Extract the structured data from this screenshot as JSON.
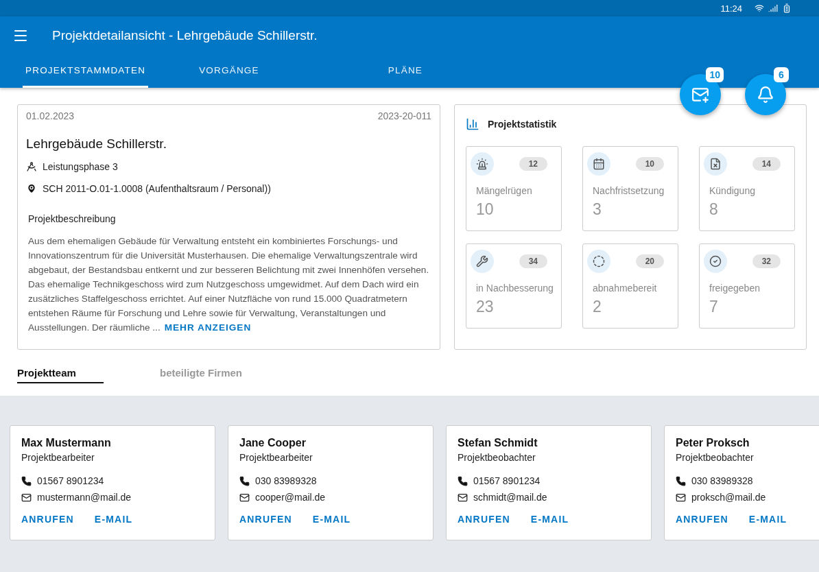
{
  "status_bar": {
    "time": "11:24"
  },
  "app_bar": {
    "title": "Projektdetailansicht - Lehrgebäude Schillerstr."
  },
  "tabs": [
    {
      "label": "PROJEKTSTAMMDATEN",
      "selected": true
    },
    {
      "label": "VORGÄNGE",
      "selected": false
    },
    {
      "label": "PLÄNE",
      "selected": false
    }
  ],
  "fabs": [
    {
      "kind": "mail",
      "badge": "10"
    },
    {
      "kind": "bell",
      "badge": "6"
    }
  ],
  "project": {
    "date": "01.02.2023",
    "number": "2023-20-011",
    "name": "Lehrgebäude Schillerstr.",
    "phase": "Leistungsphase 3",
    "location": "SCH 2011-O.01-1.0008 (Aufenthaltsraum / Personal))",
    "description_title": "Projektbeschreibung",
    "description": "Aus dem ehemaligen Gebäude für Verwaltung entsteht ein kombiniertes Forschungs- und Innovationszentrum für die Universität Musterhausen. Die ehemalige Verwaltungszentrale wird abgebaut, der Bestandsbau entkernt und zur besseren Belichtung mit zwei Innenhöfen versehen. Das ehemalige Technikgeschoss wird zum Nutzgeschoss umgewidmet. Auf dem Dach wird ein zusätzliches Staffelgeschoss errichtet. Auf einer Nutzfläche von rund 15.000 Quadratmetern entstehen Räume für Forschung und Lehre sowie für Verwaltung, Veranstaltungen und Ausstellungen. Der räumliche ...",
    "more_link": "MEHR ANZEIGEN"
  },
  "statistics": {
    "title": "Projektstatistik",
    "tiles": [
      {
        "kind": "siren",
        "badge": "12",
        "label": "Mängelrügen",
        "value": "10"
      },
      {
        "kind": "calendar",
        "badge": "10",
        "label": "Nachfristsetzung",
        "value": "3"
      },
      {
        "kind": "doc-x",
        "badge": "14",
        "label": "Kündigung",
        "value": "8"
      },
      {
        "kind": "wrench",
        "badge": "34",
        "label": "in Nachbesserung",
        "value": "23"
      },
      {
        "kind": "dashed-check",
        "badge": "20",
        "label": "abnahmebereit",
        "value": "2"
      },
      {
        "kind": "check",
        "badge": "32",
        "label": "freigegeben",
        "value": "7"
      }
    ]
  },
  "team_tabs": [
    {
      "label": "Projektteam",
      "selected": true
    },
    {
      "label": "beteiligte Firmen",
      "selected": false
    }
  ],
  "team": [
    {
      "name": "Max Mustermann",
      "role": "Projektbearbeiter",
      "phone": "01567 8901234",
      "email": "mustermann@mail.de",
      "actions": [
        "ANRUFEN",
        "E-MAIL"
      ]
    },
    {
      "name": "Jane Cooper",
      "role": "Projektbearbeiter",
      "phone": "030 83989328",
      "email": "cooper@mail.de",
      "actions": [
        "ANRUFEN",
        "E-MAIL"
      ]
    },
    {
      "name": "Stefan Schmidt",
      "role": "Projektbeobachter",
      "phone": "01567 8901234",
      "email": "schmidt@mail.de",
      "actions": [
        "ANRUFEN",
        "E-MAIL"
      ]
    },
    {
      "name": "Peter Proksch",
      "role": "Projektbeobachter",
      "phone": "030 83989328",
      "email": "proksch@mail.de",
      "actions": [
        "ANRUFEN",
        "E-MAIL"
      ]
    }
  ]
}
